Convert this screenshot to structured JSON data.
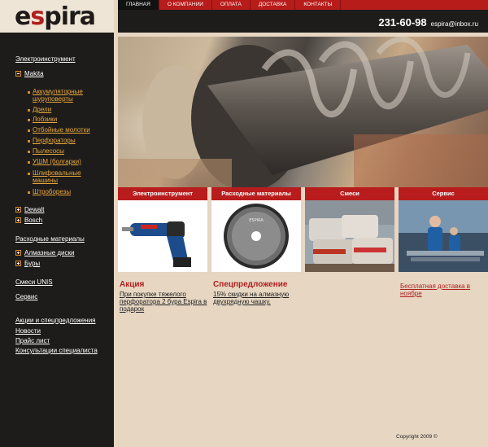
{
  "logo": {
    "pre": "e",
    "s": "s",
    "post": "pira"
  },
  "nav": [
    "главная",
    "о компании",
    "оплата",
    "доставка",
    "контакты"
  ],
  "contacts": {
    "phone": "231-60-98",
    "email": "espira@inbox.ru"
  },
  "sidebar": {
    "electro": "Электроинструмент",
    "makita": "Makita",
    "makita_items": [
      "Аккумуляторные шуруповерты",
      "Дрели",
      "Лобзики",
      "Отбойные молотки",
      "Перфораторы",
      "Пылесосы",
      "УШМ (болгарки)",
      "Шлифовальные машины",
      "Штроборезы"
    ],
    "dewalt": "Dewalt",
    "bosch": "Bosch",
    "consumables": "Расходные материалы",
    "diamond": "Алмазные диски",
    "drills": "Буры",
    "mixes": "Смеси UNIS",
    "service": "Сервис",
    "bottom_links": [
      "Акции и спецпредложения",
      "Новости",
      "Прайс лист",
      "Консультации специалиста"
    ]
  },
  "categories": [
    "Электроинструмент",
    "Расходные материалы",
    "Смеси",
    "Сервис"
  ],
  "images": {
    "disc_text": "ESPIRA"
  },
  "promos": {
    "action_title": "Акция",
    "action_text": "При покупке тяжелого перфоратора 2 бура Espira в подарок",
    "special_title": "Спецпредложение",
    "special_text": "15% скидки на алмазную двухрядную чашку.",
    "delivery_text": "Бесплатная доставка в ноябре"
  },
  "footer": "Copyright 2009 ©",
  "colors": {
    "accent": "#b71b1a",
    "dark": "#1e1c1b",
    "bg": "#e6d6c2",
    "link_orange": "#e8a83a"
  }
}
